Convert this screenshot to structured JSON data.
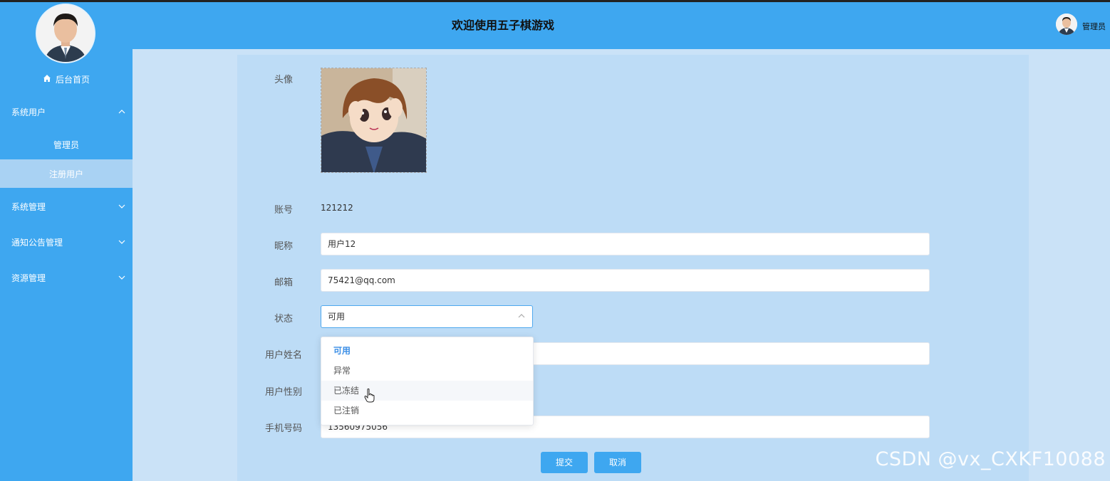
{
  "header": {
    "title": "欢迎使用五子棋游戏",
    "user": "管理员"
  },
  "sidebar": {
    "home": "后台首页",
    "groups": [
      {
        "label": "系统用户",
        "expanded": true
      },
      {
        "label": "系统管理",
        "expanded": false
      },
      {
        "label": "通知公告管理",
        "expanded": false
      },
      {
        "label": "资源管理",
        "expanded": false
      }
    ],
    "sub": [
      {
        "label": "管理员"
      },
      {
        "label": "注册用户",
        "active": true
      }
    ]
  },
  "form": {
    "avatar_label": "头像",
    "account_label": "账号",
    "account_value": "121212",
    "nickname_label": "昵称",
    "nickname_value": "用户12",
    "email_label": "邮箱",
    "email_value": "75421@qq.com",
    "status_label": "状态",
    "status_value": "可用",
    "name_label": "用户姓名",
    "gender_label": "用户性别",
    "phone_label": "手机号码",
    "phone_value": "13560975056"
  },
  "dropdown": {
    "options": [
      "可用",
      "异常",
      "已冻结",
      "已注销"
    ],
    "selected": "可用",
    "hovered": "已冻结"
  },
  "buttons": {
    "submit": "提交",
    "cancel": "取消"
  },
  "watermark": "CSDN @vx_CXKF10088",
  "colors": {
    "primary": "#3ea7f0",
    "sidebar_active": "#a9d2f3",
    "panel": "#bddcf6"
  }
}
